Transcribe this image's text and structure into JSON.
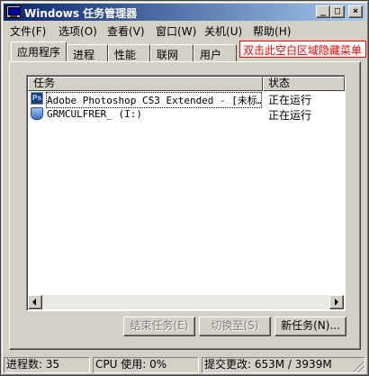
{
  "window": {
    "title": "Windows 任务管理器",
    "minimize_glyph": "_",
    "maximize_glyph": "□",
    "close_glyph": "×"
  },
  "menu": [
    {
      "label": "文件",
      "accel": "(F)"
    },
    {
      "label": "选项",
      "accel": "(O)"
    },
    {
      "label": "查看",
      "accel": "(V)"
    },
    {
      "label": "窗口",
      "accel": "(W)"
    },
    {
      "label": "关机",
      "accel": "(U)"
    },
    {
      "label": "帮助",
      "accel": "(H)"
    }
  ],
  "tabs": [
    {
      "label": "应用程序",
      "active": true
    },
    {
      "label": "进程",
      "active": false
    },
    {
      "label": "性能",
      "active": false
    },
    {
      "label": "联网",
      "active": false
    },
    {
      "label": "用户",
      "active": false
    }
  ],
  "hint": "双击此空白区域隐藏菜单",
  "list": {
    "columns": [
      "任务",
      "状态"
    ],
    "rows": [
      {
        "icon": "photoshop-icon",
        "icon_text": "Ps",
        "task": "Adobe Photoshop CS3 Extended - [未标…",
        "status": "正在运行"
      },
      {
        "icon": "removable-drive-icon",
        "task": "GRMCULFRER_ (I:)",
        "status": "正在运行"
      }
    ]
  },
  "buttons": {
    "end_task": {
      "label": "结束任务",
      "accel": "(E)"
    },
    "switch_to": {
      "label": "切换至",
      "accel": "(S)"
    },
    "new_task": {
      "label": "新任务",
      "accel": "(N)..."
    }
  },
  "statusbar": {
    "processes": "进程数: 35",
    "cpu": "CPU 使用: 0%",
    "commit": "提交更改: 653M / 3939M"
  },
  "colors": {
    "title_gradient_start": "#0a246a",
    "title_gradient_end": "#a6caf0",
    "hint_color": "#ff0000",
    "face": "#d4d0c8"
  }
}
